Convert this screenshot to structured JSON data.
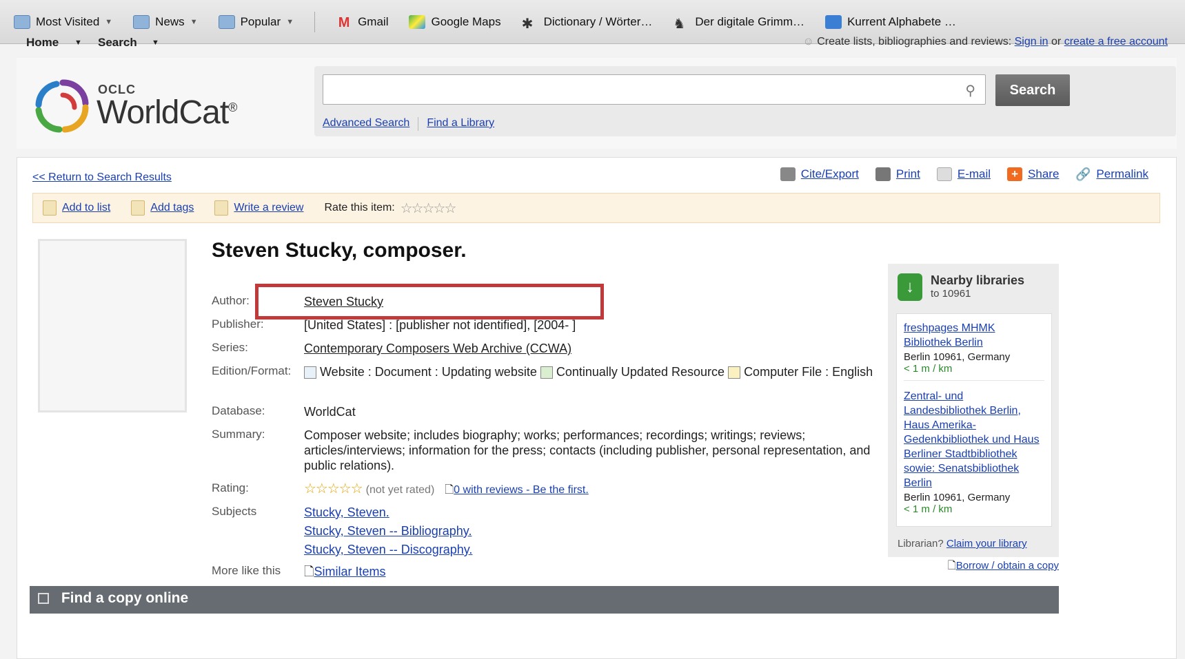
{
  "bookmarks": [
    {
      "label": "Most Visited",
      "icon": "star-folder-icon",
      "has_menu": true
    },
    {
      "label": "News",
      "icon": "folder-icon",
      "has_menu": true
    },
    {
      "label": "Popular",
      "icon": "folder-icon",
      "has_menu": true
    },
    {
      "label": "Gmail",
      "icon": "gmail-icon",
      "has_menu": false
    },
    {
      "label": "Google Maps",
      "icon": "maps-icon",
      "has_menu": false
    },
    {
      "label": "Dictionary / Wörter…",
      "icon": "dictionary-icon",
      "has_menu": false
    },
    {
      "label": "Der digitale Grimm…",
      "icon": "grimm-icon",
      "has_menu": false
    },
    {
      "label": "Kurrent Alphabete …",
      "icon": "kurrent-icon",
      "has_menu": false
    }
  ],
  "topnav": {
    "home": "Home",
    "search": "Search",
    "create_text": "Create lists, bibliographies and reviews:",
    "sign_in": "Sign in",
    "or": "or",
    "create_account": "create a free account"
  },
  "logo": {
    "oclc": "OCLC",
    "name": "WorldCat",
    "tm": "®"
  },
  "search": {
    "placeholder": "",
    "button": "Search",
    "advanced": "Advanced Search",
    "find_library": "Find a Library"
  },
  "record": {
    "return_link": "<< Return to Search Results",
    "tools": [
      "Cite/Export",
      "Print",
      "E-mail",
      "Share",
      "Permalink"
    ],
    "actions": {
      "add_list": "Add to list",
      "add_tags": "Add tags",
      "write_review": "Write a review",
      "rate": "Rate this item:"
    },
    "title": "Steven Stucky, composer.",
    "labels": {
      "author": "Author:",
      "publisher": "Publisher:",
      "series": "Series:",
      "edition": "Edition/Format:",
      "database": "Database:",
      "summary": "Summary:",
      "rating": "Rating:",
      "subjects": "Subjects",
      "more": "More like this"
    },
    "author": "Steven Stucky",
    "publisher": "[United States] : [publisher not identified], [2004- ]",
    "series": "Contemporary Composers Web Archive (CCWA)",
    "edition_parts": {
      "website": "Website : Document : Updating website",
      "continually": "Continually Updated Resource",
      "computer": "Computer File : English"
    },
    "database": "WorldCat",
    "summary": "Composer website; includes biography; works; performances; recordings; writings; reviews; articles/interviews; information for the press; contacts (including publisher, personal representation, and public relations).",
    "rating_note": "(not yet rated)",
    "reviews_link": "0 with reviews - Be the first.",
    "subjects": [
      "Stucky, Steven.",
      "Stucky, Steven -- Bibliography.",
      "Stucky, Steven -- Discography."
    ],
    "similar": "Similar Items",
    "borrow": "Borrow / obtain a copy",
    "find_copy": "Find a copy online"
  },
  "nearby": {
    "title": "Nearby libraries",
    "subtitle": "to 10961",
    "libraries": [
      {
        "name": "freshpages MHMK Bibliothek Berlin",
        "location": "Berlin 10961, Germany",
        "distance": "< 1 m / km"
      },
      {
        "name": "Zentral- und Landesbibliothek Berlin, Haus Amerika-Gedenkbibliothek und Haus Berliner Stadtbibliothek sowie: Senatsbibliothek Berlin",
        "location": "Berlin 10961, Germany",
        "distance": "< 1 m / km"
      }
    ],
    "librarian": "Librarian?",
    "claim": "Claim your library"
  },
  "colors": {
    "highlight": "#c0393b",
    "link": "#1a3fb0",
    "action_bar": "#fdf3e3"
  }
}
